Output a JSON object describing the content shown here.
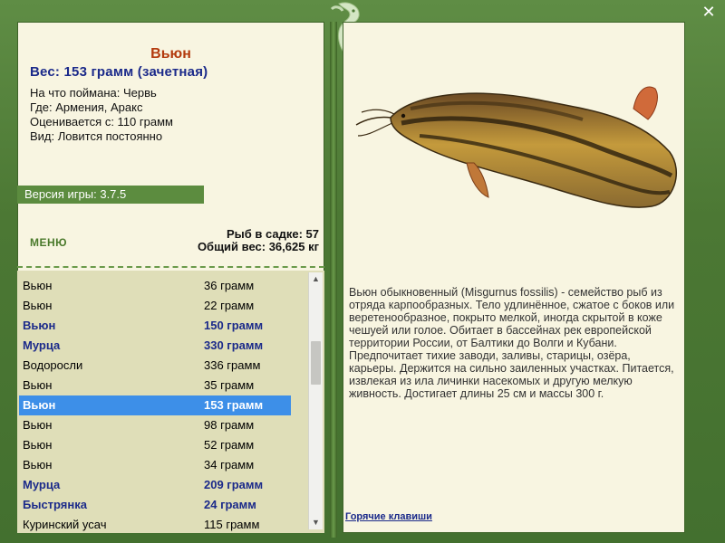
{
  "fish": {
    "title": "Вьюн",
    "weight": "Вес: 153 грамм (зачетная)",
    "bait": "На что поймана: Червь",
    "location": "Где: Армения, Аракс",
    "value": "Оценивается с: 110 грамм",
    "type": "Вид: Ловится постоянно"
  },
  "version": "Версия игры: 3.7.5",
  "menu_label": "МЕНЮ",
  "stats": {
    "keepnet": "Рыб в садке: 57",
    "total_weight": "Общий вес: 36,625 кг"
  },
  "catch_list": [
    {
      "name": "Вьюн",
      "weight": "36 грамм",
      "style": "normal"
    },
    {
      "name": "Вьюн",
      "weight": "22 грамм",
      "style": "normal"
    },
    {
      "name": "Вьюн",
      "weight": "150 грамм",
      "style": "highlight"
    },
    {
      "name": "Мурца",
      "weight": "330 грамм",
      "style": "highlight"
    },
    {
      "name": "Водоросли",
      "weight": "336 грамм",
      "style": "normal"
    },
    {
      "name": "Вьюн",
      "weight": "35 грамм",
      "style": "normal"
    },
    {
      "name": "Вьюн",
      "weight": "153 грамм",
      "style": "selected"
    },
    {
      "name": "Вьюн",
      "weight": "98 грамм",
      "style": "normal"
    },
    {
      "name": "Вьюн",
      "weight": "52 грамм",
      "style": "normal"
    },
    {
      "name": "Вьюн",
      "weight": "34 грамм",
      "style": "normal"
    },
    {
      "name": "Мурца",
      "weight": "209 грамм",
      "style": "highlight"
    },
    {
      "name": "Быстрянка",
      "weight": "24 грамм",
      "style": "highlight"
    },
    {
      "name": "Куринский усач",
      "weight": "115 грамм",
      "style": "normal"
    }
  ],
  "description": "Вьюн обыкновенный (Misgurnus fossilis) - семейство рыб из отряда карпообразных. Тело удлинённое, сжатое с боков или веретенообразное, покрыто мелкой, иногда скрытой в коже чешуей или голое. Обитает в бассейнах рек европейской территории России, от Балтики до Волги и Кубани. Предпочитает тихие заводи, заливы, старицы, озёра, карьеры. Держится на сильно заиленных участках. Питается, извлекая из ила личинки насекомых и другую мелкую живность. Достигает длины 25 см и массы 300 г.",
  "hotkeys_label": "Горячие клавиши",
  "close_symbol": "✕",
  "colors": {
    "frame": "#4e7a36",
    "panel": "#f8f5e1",
    "list_bg": "#dfdeb8",
    "selected": "#3d8fe8",
    "title": "#b33a0d",
    "highlight": "#1b2a8a"
  },
  "scroll": {
    "thumb_start": 0.24,
    "thumb_fraction": 0.19
  }
}
